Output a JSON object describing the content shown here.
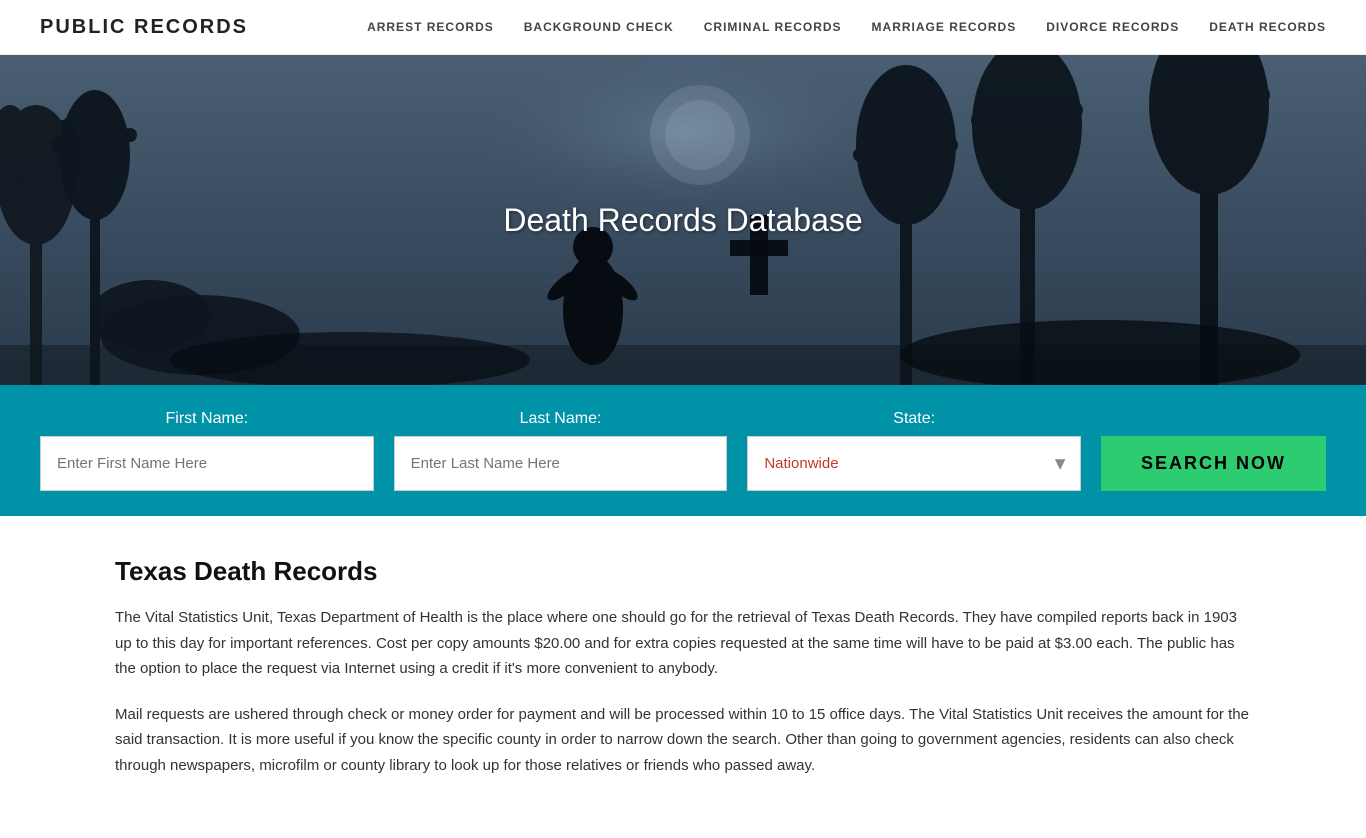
{
  "brand": "PUBLIC RECORDS",
  "nav": {
    "links": [
      {
        "label": "ARREST RECORDS",
        "href": "#"
      },
      {
        "label": "BACKGROUND CHECK",
        "href": "#"
      },
      {
        "label": "CRIMINAL RECORDS",
        "href": "#"
      },
      {
        "label": "MARRIAGE RECORDS",
        "href": "#"
      },
      {
        "label": "DIVORCE RECORDS",
        "href": "#"
      },
      {
        "label": "DEATH RECORDS",
        "href": "#"
      }
    ]
  },
  "hero": {
    "title": "Death Records Database"
  },
  "search": {
    "first_name_label": "First Name:",
    "first_name_placeholder": "Enter First Name Here",
    "last_name_label": "Last Name:",
    "last_name_placeholder": "Enter Last Name Here",
    "state_label": "State:",
    "state_value": "Nationwide",
    "search_btn_label": "SEARCH NOW"
  },
  "content": {
    "heading": "Texas Death Records",
    "paragraph1": "The Vital Statistics Unit, Texas Department of Health is the place where one should go for the retrieval of Texas Death Records. They have compiled reports back in 1903 up to this day for important references. Cost per copy amounts $20.00 and for extra copies requested at the same time will have to be paid at $3.00 each. The public has the option to place the request via Internet using a credit if it's more convenient to anybody.",
    "paragraph2": "Mail requests are ushered through check or money order for payment and will be processed within 10 to 15 office days. The Vital Statistics Unit receives the amount for the said transaction. It is more useful if you know the specific county in order to narrow down the search. Other than going to government agencies, residents can also check through newspapers, microfilm or county library to look up for those relatives or friends who passed away."
  }
}
